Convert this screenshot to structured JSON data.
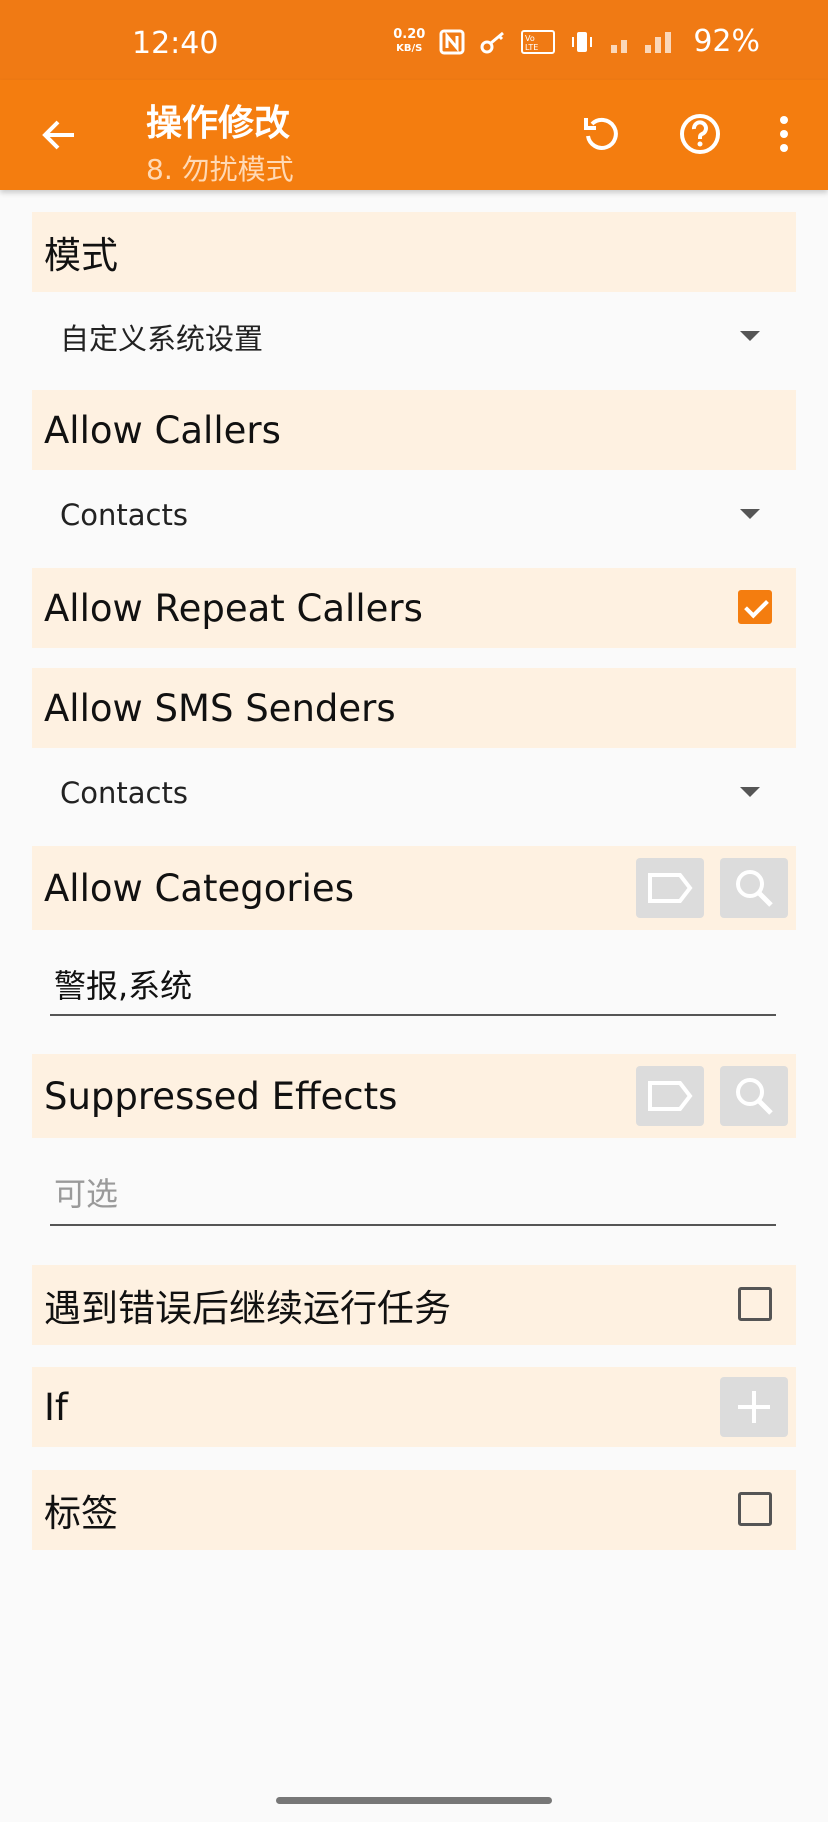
{
  "status": {
    "time": "12:40",
    "netspeed_value": "0.20",
    "netspeed_unit": "KB/S",
    "battery": "92%",
    "icons": [
      "nfc-icon",
      "key-icon",
      "volte-icon",
      "vibrate-icon",
      "signal-icon",
      "battery-icon"
    ]
  },
  "toolbar": {
    "title": "操作修改",
    "subtitle": "8. 勿扰模式",
    "icons": [
      "back-arrow-icon",
      "undo-icon",
      "help-icon",
      "overflow-menu-icon"
    ]
  },
  "form": {
    "mode_label": "模式",
    "mode_value": "自定义系统设置",
    "allow_callers_label": "Allow Callers",
    "allow_callers_value": "Contacts",
    "allow_repeat_callers_label": "Allow Repeat Callers",
    "allow_repeat_callers_checked": true,
    "allow_sms_label": "Allow SMS Senders",
    "allow_sms_value": "Contacts",
    "allow_categories_label": "Allow Categories",
    "allow_categories_value": "警报,系统",
    "suppressed_effects_label": "Suppressed Effects",
    "suppressed_effects_placeholder": "可选",
    "continue_on_error_label": "遇到错误后继续运行任务",
    "continue_on_error_checked": false,
    "if_label": "If",
    "tag_label": "标签",
    "tag_checked": false
  },
  "colors": {
    "accent": "#f47d0f",
    "section_bg": "#fef1e1",
    "button_bg": "#dcdcdc"
  }
}
